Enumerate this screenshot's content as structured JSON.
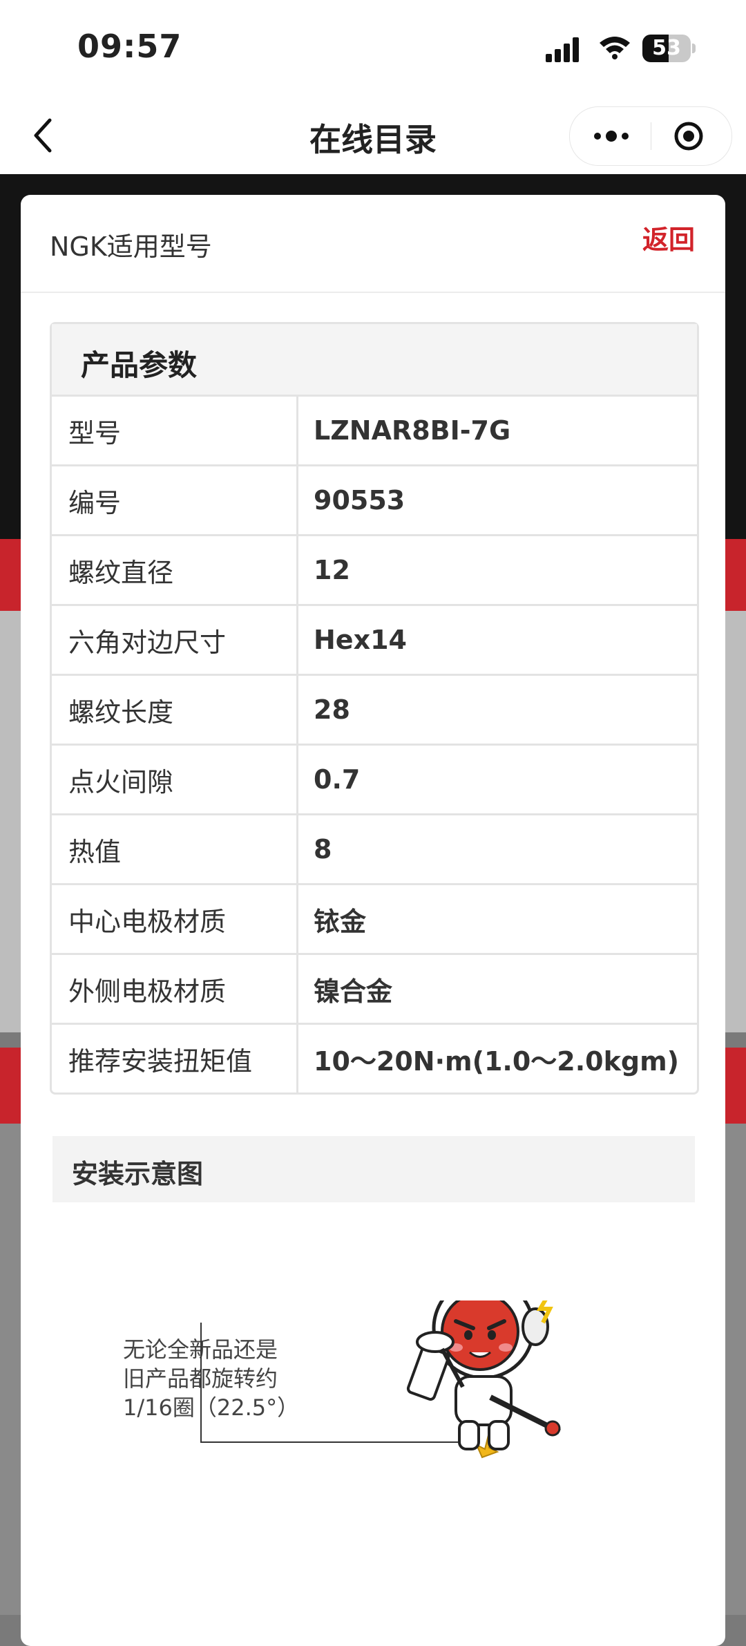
{
  "status": {
    "time": "09:57",
    "battery": "53"
  },
  "nav": {
    "title": "在线目录"
  },
  "modal": {
    "title": "NGK适用型号",
    "back_label": "返回",
    "params_title": "产品参数",
    "rows": [
      {
        "key": "型号",
        "value": "LZNAR8BI-7G"
      },
      {
        "key": "编号",
        "value": "90553"
      },
      {
        "key": "螺纹直径",
        "value": "12"
      },
      {
        "key": "六角对边尺寸",
        "value": "Hex14"
      },
      {
        "key": "螺纹长度",
        "value": "28"
      },
      {
        "key": "点火间隙",
        "value": "0.7"
      },
      {
        "key": "热值",
        "value": "8"
      },
      {
        "key": "中心电极材质",
        "value": "铱金"
      },
      {
        "key": "外侧电极材质",
        "value": "镍合金"
      },
      {
        "key": "推荐安装扭矩值",
        "value": "10～20N·m(1.0～2.0kgm)"
      }
    ],
    "install_title": "安装示意图",
    "caption_lines": [
      "无论全新品还是",
      "旧产品都旋转约",
      "1/16圈（22.5°）"
    ]
  },
  "icons": [
    "back-arrow-icon",
    "more-dots-icon",
    "target-icon",
    "signal-icon",
    "wifi-icon",
    "battery-icon"
  ],
  "colors": {
    "accent_red": "#d2232a",
    "banner_red": "#c8242c"
  }
}
